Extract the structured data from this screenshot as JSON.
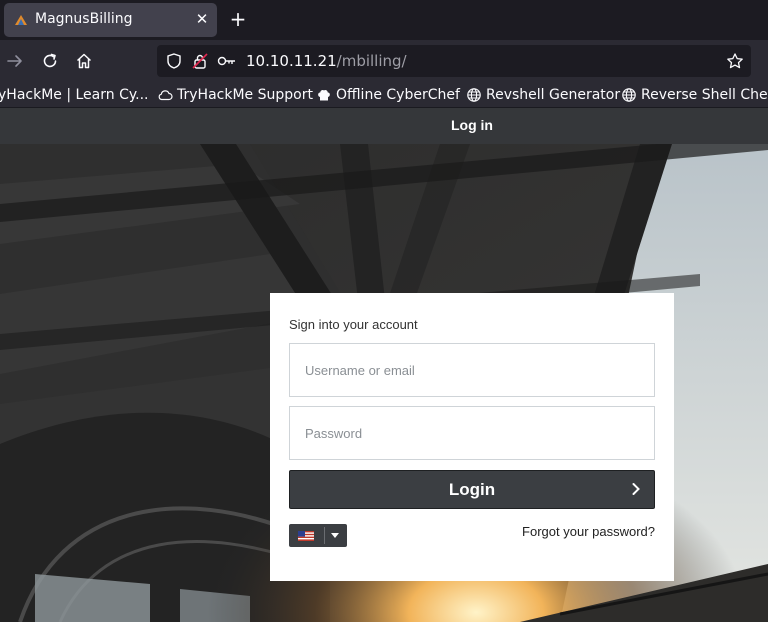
{
  "browser": {
    "tab": {
      "title": "MagnusBilling",
      "close_glyph": "✕"
    },
    "new_tab_glyph": "+",
    "url": {
      "host": "10.10.11.21",
      "path": "/mbilling/"
    },
    "bookmarks": [
      {
        "label": "yHackMe | Learn Cy...",
        "icon": "tryhackme-icon"
      },
      {
        "label": "TryHackMe Support",
        "icon": "cloud-icon"
      },
      {
        "label": "Offline CyberChef",
        "icon": "chef-hat-icon"
      },
      {
        "label": "Revshell Generator",
        "icon": "globe-icon"
      },
      {
        "label": "Reverse Shell Cheat",
        "icon": "globe-icon"
      }
    ]
  },
  "page": {
    "header_title": "Log in",
    "login": {
      "heading": "Sign into your account",
      "username_placeholder": "Username or email",
      "password_placeholder": "Password",
      "button_label": "Login",
      "forgot_label": "Forgot your password?",
      "language_icon": "us-flag-icon"
    }
  },
  "colors": {
    "chrome_dark": "#1c1b22",
    "chrome_toolbar": "#2b2a33",
    "page_header": "#35373a",
    "login_button": "#3b3e42"
  }
}
